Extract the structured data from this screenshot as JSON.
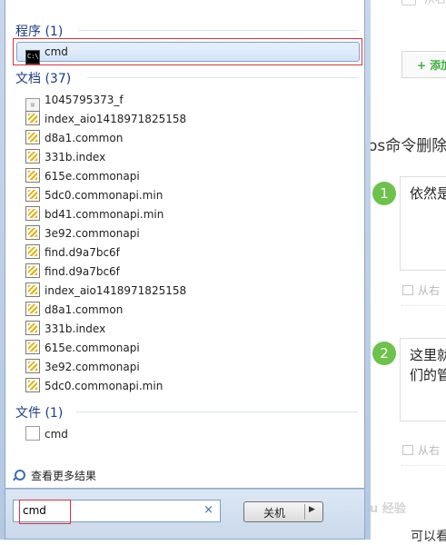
{
  "background_page": {
    "top_text": "从右",
    "add_button": "+ 添加",
    "heading": "os命令删除",
    "steps": [
      {
        "number": "1",
        "text_lines": [
          "依然是"
        ]
      },
      {
        "number": "2",
        "text_lines": [
          "这里就",
          "们的管"
        ]
      }
    ],
    "image_source_label": "从右",
    "bottom_text": "可以看",
    "watermark": "Bai du 经验"
  },
  "start_menu": {
    "programs": {
      "header": "程序 (1)",
      "items": [
        {
          "label": "cmd",
          "icon": "cmd-icon"
        }
      ]
    },
    "documents": {
      "header": "文档 (37)",
      "items": [
        {
          "label": "1045795373_f",
          "icon": "file-icon"
        },
        {
          "label": "index_aio1418971825158",
          "icon": "script-icon"
        },
        {
          "label": "d8a1.common",
          "icon": "script-icon"
        },
        {
          "label": "331b.index",
          "icon": "script-icon"
        },
        {
          "label": "615e.commonapi",
          "icon": "script-icon"
        },
        {
          "label": "5dc0.commonapi.min",
          "icon": "script-icon"
        },
        {
          "label": "bd41.commonapi.min",
          "icon": "script-icon"
        },
        {
          "label": "3e92.commonapi",
          "icon": "script-icon"
        },
        {
          "label": "find.d9a7bc6f",
          "icon": "script-icon"
        },
        {
          "label": "find.d9a7bc6f",
          "icon": "script-icon"
        },
        {
          "label": "index_aio1418971825158",
          "icon": "script-icon"
        },
        {
          "label": "d8a1.common",
          "icon": "script-icon"
        },
        {
          "label": "331b.index",
          "icon": "script-icon"
        },
        {
          "label": "615e.commonapi",
          "icon": "script-icon"
        },
        {
          "label": "3e92.commonapi",
          "icon": "script-icon"
        },
        {
          "label": "5dc0.commonapi.min",
          "icon": "script-icon"
        }
      ]
    },
    "files": {
      "header": "文件 (1)",
      "items": [
        {
          "label": "cmd",
          "icon": "blank-file-icon"
        }
      ]
    },
    "see_more": "查看更多结果",
    "search": {
      "value": "cmd",
      "clear_glyph": "×"
    },
    "shutdown": {
      "label": "关机",
      "arrow": "▶"
    }
  },
  "colors": {
    "category_header": "#1e3b8a",
    "highlight_border": "#e0303a",
    "selection": "#d3e4f7",
    "step_badge": "#6cc24a"
  }
}
